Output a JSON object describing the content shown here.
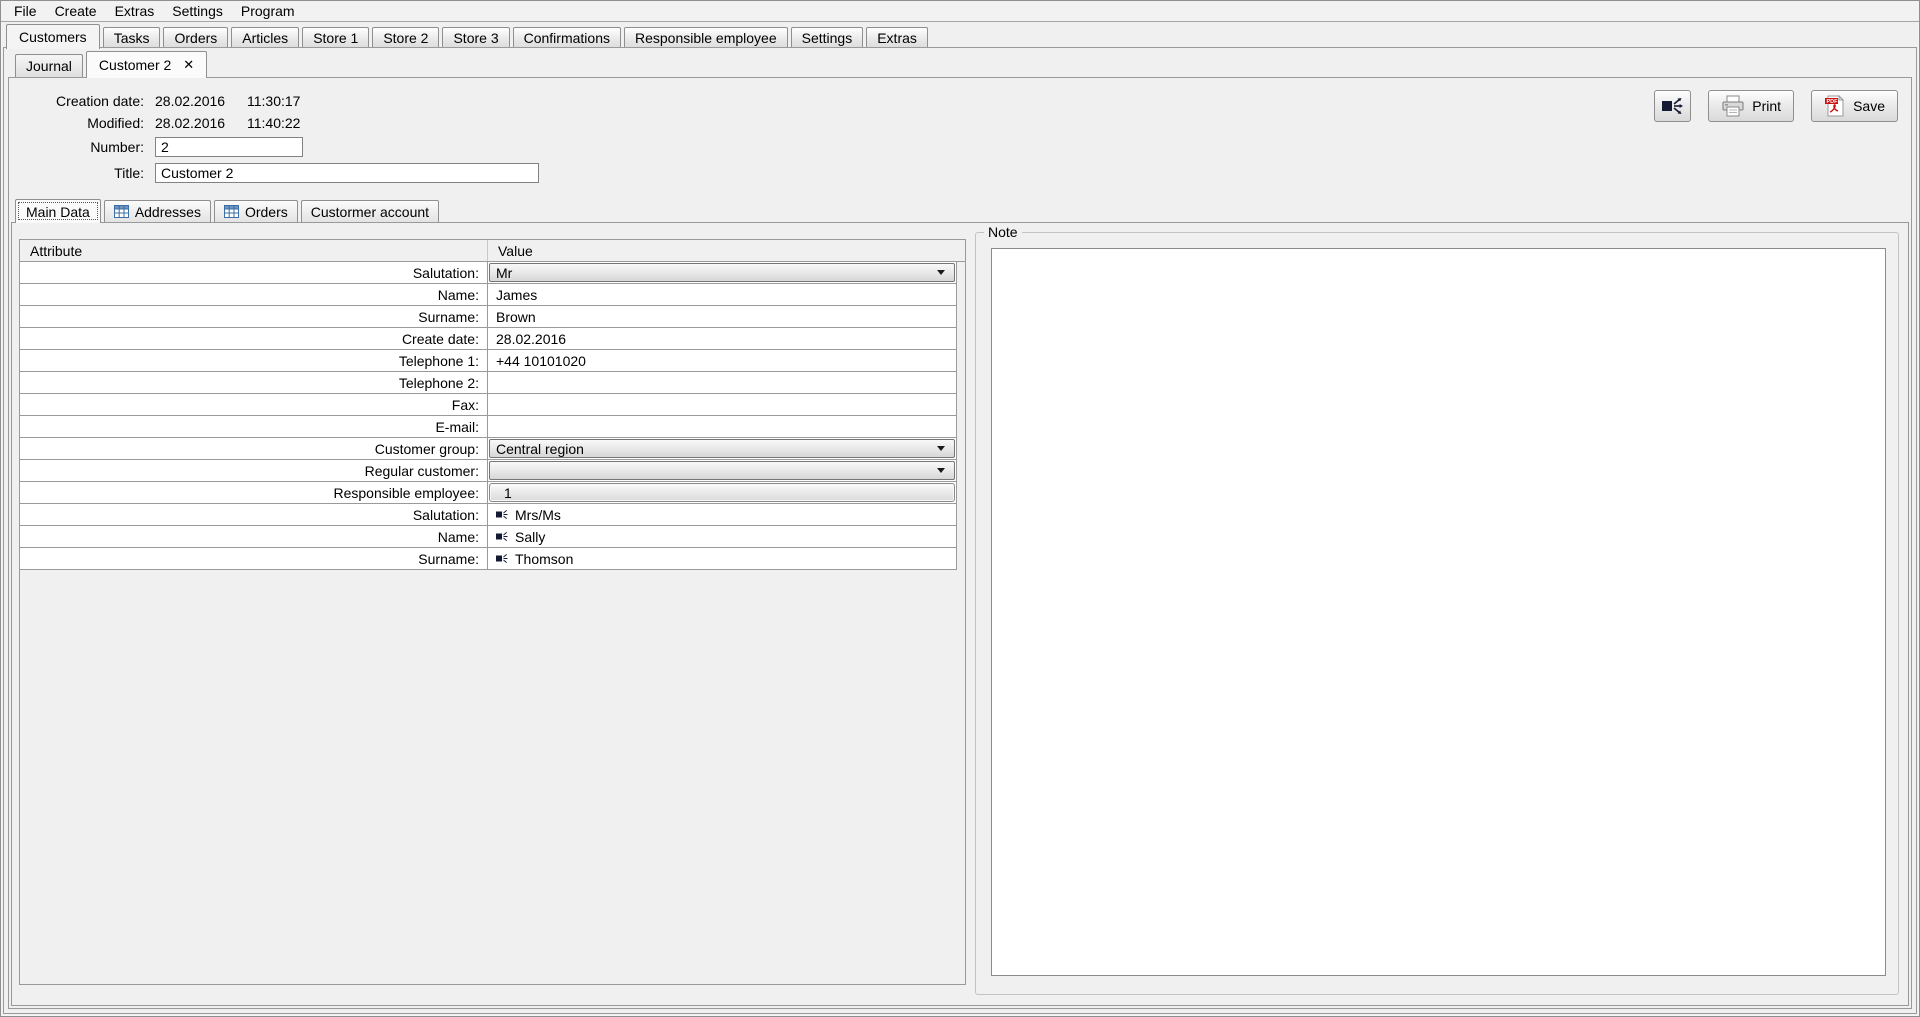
{
  "menu": {
    "items": [
      "File",
      "Create",
      "Extras",
      "Settings",
      "Program"
    ]
  },
  "main_tabs": {
    "active": "Customers",
    "items": [
      "Customers",
      "Tasks",
      "Orders",
      "Articles",
      "Store 1",
      "Store 2",
      "Store 3",
      "Confirmations",
      "Responsible employee",
      "Settings",
      "Extras"
    ]
  },
  "doc_tabs": {
    "active": "Customer 2",
    "items": [
      "Journal",
      "Customer 2"
    ],
    "close_glyph": "✕"
  },
  "header": {
    "creation_date_label": "Creation date:",
    "creation_date": "28.02.2016",
    "creation_time": "11:30:17",
    "modified_label": "Modified:",
    "modified_date": "28.02.2016",
    "modified_time": "11:40:22",
    "number_label": "Number:",
    "number_value": "2",
    "title_label": "Title:",
    "title_value": "Customer 2",
    "print_label": "Print",
    "save_label": "Save"
  },
  "detail_tabs": {
    "active": "Main Data",
    "items": [
      {
        "label": "Main Data",
        "icon": ""
      },
      {
        "label": "Addresses",
        "icon": "table-icon"
      },
      {
        "label": "Orders",
        "icon": "table-icon"
      },
      {
        "label": "Custormer account",
        "icon": ""
      }
    ]
  },
  "table": {
    "headers": [
      "Attribute",
      "Value"
    ],
    "rows": [
      {
        "label": "Salutation:",
        "value": "Mr",
        "type": "combo"
      },
      {
        "label": "Name:",
        "value": "James",
        "type": "text"
      },
      {
        "label": "Surname:",
        "value": "Brown",
        "type": "text"
      },
      {
        "label": "Create date:",
        "value": "28.02.2016",
        "type": "text"
      },
      {
        "label": "Telephone 1:",
        "value": "+44 10101020",
        "type": "text"
      },
      {
        "label": "Telephone 2:",
        "value": "",
        "type": "text"
      },
      {
        "label": "Fax:",
        "value": "",
        "type": "text"
      },
      {
        "label": "E-mail:",
        "value": "",
        "type": "text"
      },
      {
        "label": "Customer group:",
        "value": "Central region",
        "type": "combo"
      },
      {
        "label": "Regular customer:",
        "value": "",
        "type": "combo"
      },
      {
        "label": "Responsible employee:",
        "value": "1",
        "type": "button"
      },
      {
        "label": "Salutation:",
        "value": "Mrs/Ms",
        "type": "linked"
      },
      {
        "label": "Name:",
        "value": "Sally",
        "type": "linked"
      },
      {
        "label": "Surname:",
        "value": "Thomson",
        "type": "linked"
      }
    ]
  },
  "note": {
    "label": "Note",
    "content": ""
  },
  "colors": {
    "panel_bg": "#f0f0f0",
    "grid_border": "#9a9a9a",
    "pdf_red": "#cc1111",
    "link_icon_navy": "#141a33",
    "table_icon_blue": "#3a6ea5"
  }
}
